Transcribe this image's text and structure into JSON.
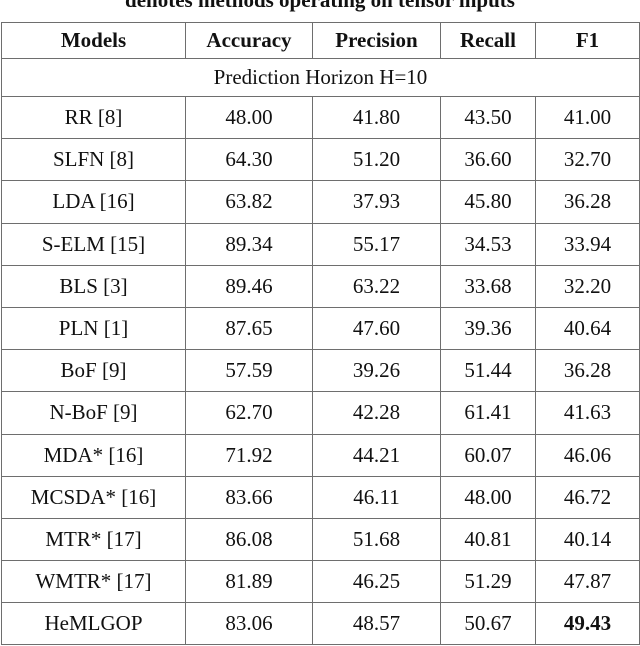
{
  "caption": "denotes methods operating on tensor inputs",
  "table": {
    "headers": [
      "Models",
      "Accuracy",
      "Precision",
      "Recall",
      "F1"
    ],
    "section": "Prediction Horizon H=10",
    "rows": [
      {
        "model": "RR [8]",
        "accuracy": "48.00",
        "precision": "41.80",
        "recall": "43.50",
        "f1": "41.00"
      },
      {
        "model": "SLFN [8]",
        "accuracy": "64.30",
        "precision": "51.20",
        "recall": "36.60",
        "f1": "32.70"
      },
      {
        "model": "LDA [16]",
        "accuracy": "63.82",
        "precision": "37.93",
        "recall": "45.80",
        "f1": "36.28"
      },
      {
        "model": "S-ELM [15]",
        "accuracy": "89.34",
        "precision": "55.17",
        "recall": "34.53",
        "f1": "33.94"
      },
      {
        "model": "BLS [3]",
        "accuracy": "89.46",
        "precision": "63.22",
        "recall": "33.68",
        "f1": "32.20"
      },
      {
        "model": "PLN [1]",
        "accuracy": "87.65",
        "precision": "47.60",
        "recall": "39.36",
        "f1": "40.64"
      },
      {
        "model": "BoF [9]",
        "accuracy": "57.59",
        "precision": "39.26",
        "recall": "51.44",
        "f1": "36.28"
      },
      {
        "model": "N-BoF [9]",
        "accuracy": "62.70",
        "precision": "42.28",
        "recall": "61.41",
        "f1": "41.63"
      },
      {
        "model": "MDA* [16]",
        "accuracy": "71.92",
        "precision": "44.21",
        "recall": "60.07",
        "f1": "46.06"
      },
      {
        "model": "MCSDA* [16]",
        "accuracy": "83.66",
        "precision": "46.11",
        "recall": "48.00",
        "f1": "46.72"
      },
      {
        "model": "MTR* [17]",
        "accuracy": "86.08",
        "precision": "51.68",
        "recall": "40.81",
        "f1": "40.14"
      },
      {
        "model": "WMTR* [17]",
        "accuracy": "81.89",
        "precision": "46.25",
        "recall": "51.29",
        "f1": "47.87"
      },
      {
        "model": "HeMLGOP",
        "accuracy": "83.06",
        "precision": "48.57",
        "recall": "50.67",
        "f1": "49.43",
        "bold_fields": [
          "f1"
        ]
      }
    ]
  }
}
